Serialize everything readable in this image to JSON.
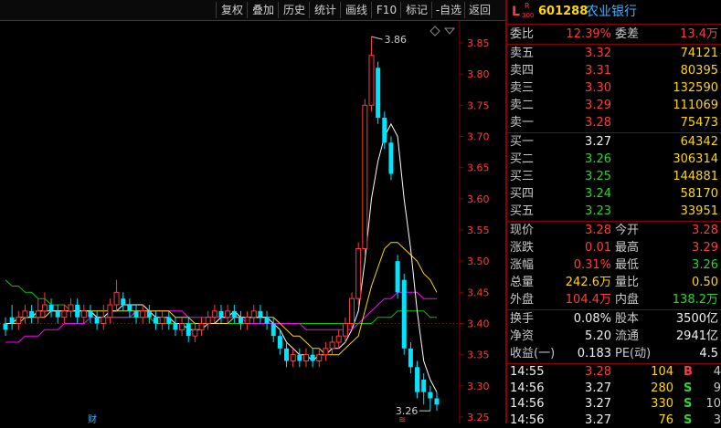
{
  "toolbar": {
    "buttons": [
      "复权",
      "叠加",
      "历史",
      "统计",
      "画线",
      "F10",
      "标记",
      "-自选",
      "返回"
    ]
  },
  "chart": {
    "y_ticks": [
      "3.85",
      "3.80",
      "3.75",
      "3.70",
      "3.65",
      "3.60",
      "3.55",
      "3.50",
      "3.45",
      "3.40",
      "3.35",
      "3.30",
      "3.25"
    ],
    "high_label": "3.86",
    "low_label": "3.26",
    "event_marker_1": "财",
    "event_marker_2": "≋",
    "colors": {
      "up": "#ff3b3b",
      "down": "#00e5ff",
      "ma5": "#ffffff",
      "ma10": "#ffd700",
      "ma20": "#ff00ff",
      "ma60": "#00c800"
    },
    "candles": [
      [
        3.4,
        3.39,
        3.41,
        3.38
      ],
      [
        3.41,
        3.4,
        3.43,
        3.39
      ],
      [
        3.4,
        3.41,
        3.42,
        3.39
      ],
      [
        3.41,
        3.42,
        3.43,
        3.4
      ],
      [
        3.42,
        3.41,
        3.43,
        3.4
      ],
      [
        3.41,
        3.42,
        3.44,
        3.4
      ],
      [
        3.42,
        3.43,
        3.45,
        3.41
      ],
      [
        3.43,
        3.42,
        3.44,
        3.41
      ],
      [
        3.42,
        3.41,
        3.43,
        3.4
      ],
      [
        3.41,
        3.42,
        3.43,
        3.4
      ],
      [
        3.42,
        3.43,
        3.44,
        3.41
      ],
      [
        3.43,
        3.41,
        3.44,
        3.4
      ],
      [
        3.41,
        3.42,
        3.43,
        3.4
      ],
      [
        3.42,
        3.41,
        3.43,
        3.4
      ],
      [
        3.41,
        3.4,
        3.42,
        3.39
      ],
      [
        3.4,
        3.41,
        3.43,
        3.39
      ],
      [
        3.41,
        3.43,
        3.44,
        3.4
      ],
      [
        3.43,
        3.45,
        3.47,
        3.42
      ],
      [
        3.44,
        3.43,
        3.45,
        3.42
      ],
      [
        3.43,
        3.42,
        3.44,
        3.41
      ],
      [
        3.42,
        3.41,
        3.43,
        3.4
      ],
      [
        3.41,
        3.42,
        3.43,
        3.4
      ],
      [
        3.42,
        3.41,
        3.43,
        3.4
      ],
      [
        3.41,
        3.4,
        3.42,
        3.39
      ],
      [
        3.4,
        3.41,
        3.42,
        3.39
      ],
      [
        3.41,
        3.4,
        3.42,
        3.39
      ],
      [
        3.4,
        3.39,
        3.41,
        3.38
      ],
      [
        3.39,
        3.4,
        3.41,
        3.38
      ],
      [
        3.4,
        3.38,
        3.41,
        3.37
      ],
      [
        3.38,
        3.39,
        3.4,
        3.37
      ],
      [
        3.39,
        3.4,
        3.41,
        3.38
      ],
      [
        3.4,
        3.41,
        3.42,
        3.39
      ],
      [
        3.41,
        3.42,
        3.43,
        3.4
      ],
      [
        3.42,
        3.41,
        3.43,
        3.4
      ],
      [
        3.41,
        3.42,
        3.43,
        3.4
      ],
      [
        3.42,
        3.41,
        3.43,
        3.4
      ],
      [
        3.41,
        3.4,
        3.42,
        3.39
      ],
      [
        3.4,
        3.41,
        3.42,
        3.39
      ],
      [
        3.41,
        3.42,
        3.43,
        3.4
      ],
      [
        3.42,
        3.41,
        3.43,
        3.4
      ],
      [
        3.41,
        3.4,
        3.42,
        3.39
      ],
      [
        3.4,
        3.38,
        3.41,
        3.37
      ],
      [
        3.38,
        3.36,
        3.39,
        3.35
      ],
      [
        3.36,
        3.34,
        3.37,
        3.33
      ],
      [
        3.34,
        3.35,
        3.36,
        3.33
      ],
      [
        3.35,
        3.34,
        3.36,
        3.33
      ],
      [
        3.34,
        3.35,
        3.36,
        3.33
      ],
      [
        3.35,
        3.34,
        3.36,
        3.33
      ],
      [
        3.34,
        3.35,
        3.36,
        3.33
      ],
      [
        3.35,
        3.36,
        3.37,
        3.34
      ],
      [
        3.36,
        3.37,
        3.38,
        3.35
      ],
      [
        3.37,
        3.38,
        3.39,
        3.36
      ],
      [
        3.38,
        3.4,
        3.41,
        3.37
      ],
      [
        3.4,
        3.44,
        3.45,
        3.39
      ],
      [
        3.44,
        3.52,
        3.53,
        3.43
      ],
      [
        3.52,
        3.75,
        3.76,
        3.51
      ],
      [
        3.75,
        3.83,
        3.86,
        3.74
      ],
      [
        3.81,
        3.73,
        3.82,
        3.72
      ],
      [
        3.73,
        3.69,
        3.74,
        3.68
      ],
      [
        3.69,
        3.64,
        3.7,
        3.63
      ],
      [
        3.5,
        3.45,
        3.51,
        3.44
      ],
      [
        3.47,
        3.36,
        3.48,
        3.35
      ],
      [
        3.36,
        3.33,
        3.37,
        3.32
      ],
      [
        3.33,
        3.29,
        3.34,
        3.28
      ],
      [
        3.31,
        3.29,
        3.32,
        3.27
      ],
      [
        3.29,
        3.28,
        3.3,
        3.26
      ],
      [
        3.28,
        3.27,
        3.29,
        3.26
      ]
    ],
    "ma5": [
      3.4,
      3.4,
      3.41,
      3.41,
      3.41,
      3.42,
      3.42,
      3.42,
      3.42,
      3.42,
      3.42,
      3.42,
      3.42,
      3.42,
      3.41,
      3.41,
      3.42,
      3.42,
      3.43,
      3.43,
      3.43,
      3.43,
      3.42,
      3.41,
      3.41,
      3.41,
      3.4,
      3.4,
      3.39,
      3.39,
      3.39,
      3.4,
      3.4,
      3.41,
      3.41,
      3.42,
      3.41,
      3.41,
      3.41,
      3.41,
      3.41,
      3.4,
      3.39,
      3.37,
      3.36,
      3.35,
      3.35,
      3.34,
      3.35,
      3.35,
      3.36,
      3.36,
      3.37,
      3.39,
      3.42,
      3.5,
      3.6,
      3.66,
      3.7,
      3.72,
      3.7,
      3.6,
      3.52,
      3.42,
      3.34,
      3.31,
      3.29
    ],
    "ma10": [
      3.4,
      3.4,
      3.4,
      3.41,
      3.41,
      3.41,
      3.41,
      3.42,
      3.42,
      3.42,
      3.42,
      3.42,
      3.42,
      3.42,
      3.42,
      3.42,
      3.42,
      3.42,
      3.42,
      3.42,
      3.42,
      3.42,
      3.42,
      3.42,
      3.42,
      3.42,
      3.41,
      3.41,
      3.41,
      3.4,
      3.4,
      3.4,
      3.4,
      3.4,
      3.4,
      3.41,
      3.41,
      3.41,
      3.41,
      3.41,
      3.41,
      3.41,
      3.4,
      3.39,
      3.38,
      3.38,
      3.37,
      3.36,
      3.36,
      3.35,
      3.35,
      3.35,
      3.36,
      3.37,
      3.38,
      3.42,
      3.46,
      3.49,
      3.52,
      3.53,
      3.53,
      3.52,
      3.51,
      3.5,
      3.48,
      3.47,
      3.45
    ],
    "ma20": [
      3.37,
      3.37,
      3.37,
      3.38,
      3.38,
      3.38,
      3.39,
      3.39,
      3.39,
      3.4,
      3.4,
      3.4,
      3.4,
      3.41,
      3.41,
      3.41,
      3.41,
      3.41,
      3.41,
      3.41,
      3.42,
      3.42,
      3.42,
      3.42,
      3.42,
      3.42,
      3.42,
      3.42,
      3.41,
      3.41,
      3.41,
      3.41,
      3.41,
      3.41,
      3.41,
      3.41,
      3.41,
      3.4,
      3.4,
      3.4,
      3.4,
      3.4,
      3.4,
      3.4,
      3.4,
      3.4,
      3.39,
      3.39,
      3.39,
      3.39,
      3.39,
      3.39,
      3.39,
      3.39,
      3.4,
      3.41,
      3.42,
      3.43,
      3.44,
      3.44,
      3.45,
      3.45,
      3.45,
      3.45,
      3.44,
      3.44,
      3.44
    ],
    "ma60": [
      3.47,
      3.46,
      3.46,
      3.45,
      3.45,
      3.44,
      3.44,
      3.43,
      3.43,
      3.43,
      3.42,
      3.42,
      3.42,
      3.42,
      3.41,
      3.41,
      3.41,
      3.41,
      3.41,
      3.41,
      3.41,
      3.41,
      3.41,
      3.4,
      3.4,
      3.4,
      3.4,
      3.4,
      3.4,
      3.4,
      3.4,
      3.4,
      3.4,
      3.4,
      3.4,
      3.4,
      3.4,
      3.4,
      3.4,
      3.4,
      3.4,
      3.4,
      3.4,
      3.4,
      3.4,
      3.4,
      3.4,
      3.4,
      3.4,
      3.4,
      3.4,
      3.4,
      3.4,
      3.4,
      3.4,
      3.4,
      3.4,
      3.41,
      3.41,
      3.41,
      3.42,
      3.42,
      3.42,
      3.42,
      3.42,
      3.41,
      3.41
    ]
  },
  "quote": {
    "market_prefix": "L",
    "badge_top": "R",
    "badge_bottom": "300",
    "code": "601288",
    "name": "农业银行",
    "weibi_label": "委比",
    "weibi_value": "12.39%",
    "weicha_label": "委差",
    "weicha_value": "13.4万",
    "asks": [
      {
        "label": "卖五",
        "price": "3.32",
        "volume": "74121"
      },
      {
        "label": "卖四",
        "price": "3.31",
        "volume": "80395"
      },
      {
        "label": "卖三",
        "price": "3.30",
        "volume": "132590"
      },
      {
        "label": "卖二",
        "price": "3.29",
        "volume": "111069"
      },
      {
        "label": "卖一",
        "price": "3.28",
        "volume": "75473"
      }
    ],
    "bids": [
      {
        "label": "买一",
        "price": "3.27",
        "volume": "64342"
      },
      {
        "label": "买二",
        "price": "3.26",
        "volume": "306314"
      },
      {
        "label": "买三",
        "price": "3.25",
        "volume": "144881"
      },
      {
        "label": "买四",
        "price": "3.24",
        "volume": "58170"
      },
      {
        "label": "买五",
        "price": "3.23",
        "volume": "33951"
      }
    ],
    "stats": [
      {
        "l1": "现价",
        "v1": "3.28",
        "c1": "red",
        "l2": "今开",
        "v2": "3.28",
        "c2": "red"
      },
      {
        "l1": "涨跌",
        "v1": "0.01",
        "c1": "red",
        "l2": "最高",
        "v2": "3.29",
        "c2": "red"
      },
      {
        "l1": "涨幅",
        "v1": "0.31%",
        "c1": "red",
        "l2": "最低",
        "v2": "3.26",
        "c2": "green"
      },
      {
        "l1": "总量",
        "v1": "242.6万",
        "c1": "yellow",
        "l2": "量比",
        "v2": "0.50",
        "c2": "yellow"
      },
      {
        "l1": "外盘",
        "v1": "104.4万",
        "c1": "red",
        "l2": "内盘",
        "v2": "138.2万",
        "c2": "green"
      }
    ],
    "stats2": [
      {
        "l1": "换手",
        "v1": "0.08%",
        "l2": "股本",
        "v2": "3500亿"
      },
      {
        "l1": "净资",
        "v1": "5.20",
        "l2": "流通",
        "v2": "2941亿"
      },
      {
        "l1": "收益(一)",
        "v1": "0.183",
        "l2": "PE(动)",
        "v2": "4.5"
      }
    ],
    "trades": [
      {
        "time": "14:55",
        "price": "3.28",
        "pc": "red",
        "vol": "104",
        "side": "B",
        "sc": "red",
        "n": "4"
      },
      {
        "time": "14:56",
        "price": "3.27",
        "pc": "white",
        "vol": "280",
        "side": "S",
        "sc": "green",
        "n": "9"
      },
      {
        "time": "14:56",
        "price": "3.27",
        "pc": "white",
        "vol": "330",
        "side": "S",
        "sc": "green",
        "n": "10"
      },
      {
        "time": "14:56",
        "price": "3.27",
        "pc": "white",
        "vol": "76",
        "side": "S",
        "sc": "green",
        "n": "3"
      }
    ]
  }
}
